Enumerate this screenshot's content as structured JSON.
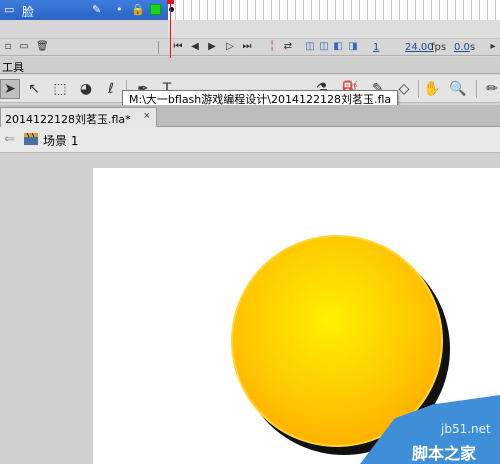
{
  "timeline": {
    "layer_name": "脸",
    "frame_number": "1",
    "fps": "24.00",
    "fps_unit": "fps",
    "elapsed": "0.0",
    "elapsed_unit": "s"
  },
  "tools_panel": {
    "label": "工具"
  },
  "tooltip": {
    "text": "M:\\大一bflash游戏编程设计\\2014122128刘茗玉.fla"
  },
  "document_tab": {
    "title": "2014122128刘茗玉.fla*",
    "close_symbol": "×"
  },
  "scene": {
    "label": "场景 1"
  },
  "stage": {
    "ball_color_center": "#fff200",
    "ball_color_edge": "#f7a200",
    "shadow_color": "#111111"
  },
  "watermark": {
    "site": "jb51.net",
    "brand": "脚本之家"
  }
}
